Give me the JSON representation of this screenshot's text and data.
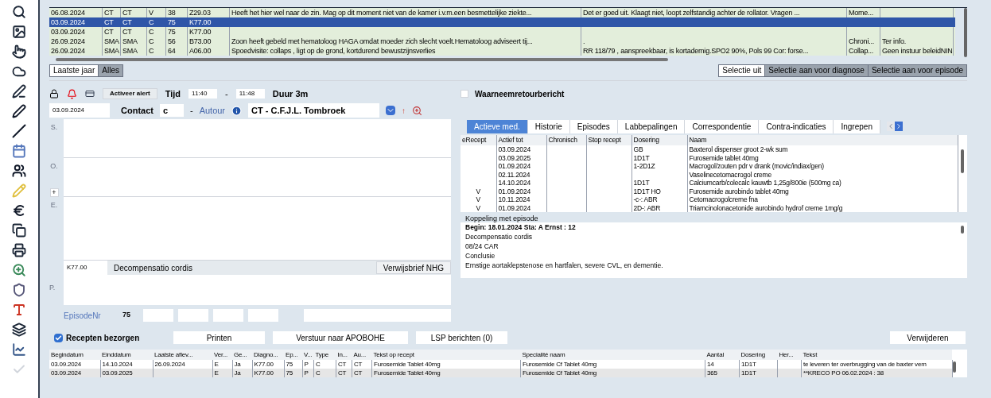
{
  "journal_table": {
    "rows": [
      {
        "selected": false,
        "cells": [
          "06.08.2024",
          "CT",
          "CT",
          "V",
          "38",
          "Z29.03",
          "Heeft het hier wel naar de zin. Mag op dit moment niet van de kamer i.v.m.een besmettelijke ziekte...",
          "Det er goed uit. Klaagt niet, loopt zelfstandig achter de rollator. Vragen ...",
          "Mome...",
          ""
        ]
      },
      {
        "selected": true,
        "cells": [
          "03.09.2024",
          "CT",
          "CT",
          "C",
          "75",
          "K77.00",
          "",
          "",
          "",
          ""
        ]
      },
      {
        "selected": false,
        "cells": [
          "03.09.2024",
          "CT",
          "CT",
          "C",
          "75",
          "K77.00",
          "",
          "",
          "",
          ""
        ]
      },
      {
        "selected": false,
        "cells": [
          "26.09.2024",
          "SMA",
          "SMA",
          "C",
          "56",
          "B73.00",
          "Zoon heeft gebeld met hematoloog HAGA omdat moeder zich slecht voelt.Hematoloog adviseert tij...",
          ".",
          "Chroni...",
          "Ter info."
        ]
      },
      {
        "selected": false,
        "cells": [
          "26.09.2024",
          "SMA",
          "SMA",
          "C",
          "64",
          "A06.00",
          "Spoedvisite: collaps , ligt op de grond, kortdurend bewustzijnsverlies",
          "RR 118/79 , aanspreekbaar, is kortademig.SPO2 90%, Pols 99 Cor: forse...",
          "Collap...",
          "Geen instuur beleidNIN"
        ]
      }
    ]
  },
  "period_filter": [
    {
      "label": "Laatste jaar",
      "selected": true
    },
    {
      "label": "Alles",
      "selected": false
    }
  ],
  "selection_filter": [
    {
      "label": "Selectie uit",
      "selected": true
    },
    {
      "label": "Selectie aan voor diagnose",
      "selected": false
    },
    {
      "label": "Selectie aan voor episode",
      "selected": false
    }
  ],
  "consult": {
    "alert_button": "Activeer alert",
    "time_label": "Tijd",
    "time_from": "11:40",
    "time_sep": "-",
    "time_to": "11:48",
    "duration": "Duur 3m",
    "date": "03.09.2024",
    "contact_label": "Contact",
    "contact_value": "c",
    "contact_sep": "-",
    "author_link": "Autour",
    "author": "CT - C.F.J.L. Tombroek",
    "author_mark": "↑",
    "soep": [
      {
        "label": "S."
      },
      {
        "label": "O."
      },
      {
        "label": "E."
      }
    ],
    "o_add": "+",
    "diagnosis_code": "K77.00",
    "diagnosis_text": "Decompensatio cordis",
    "referral_button": "Verwijsbrief NHG",
    "p_label": "P.",
    "episode_label": "EpisodeNr",
    "episode_value": "75"
  },
  "observer_report": {
    "label": "Waarneemretourbericht",
    "checked": false
  },
  "tabs": [
    {
      "label": "Actieve med.",
      "selected": true
    },
    {
      "label": "Historie",
      "selected": false
    },
    {
      "label": "Episodes",
      "selected": false
    },
    {
      "label": "Labbepalingen",
      "selected": false
    },
    {
      "label": "Correspondentie",
      "selected": false
    },
    {
      "label": "Contra-indicaties",
      "selected": false
    },
    {
      "label": "Ingrepen",
      "selected": false
    }
  ],
  "medication_table": {
    "columns": [
      "eRecept",
      "Actief tot",
      "Chronisch",
      "Stop recept",
      "Dosering",
      "Naam"
    ],
    "rows": [
      [
        "",
        "03.09.2024",
        "",
        "",
        "GB",
        "Baxterol dispenser groot 2-wk sum"
      ],
      [
        "",
        "03.09.2025",
        "",
        "",
        "1D1T",
        "Furosemide tablet 40mg"
      ],
      [
        "",
        "01.09.2024",
        "",
        "",
        "1-2D1Z",
        "Macrogol/zouten pdr v drank (movic/indiax/gen)"
      ],
      [
        "",
        "02.11.2024",
        "",
        "",
        "",
        "Vaselinecetomacrogol creme"
      ],
      [
        "",
        "14.10.2024",
        "",
        "",
        "1D1T",
        "Calciumcarb/colecalc kauwtb 1,25g/800ie (500mg ca)"
      ],
      [
        "V",
        "01.09.2024",
        "",
        "",
        "1D1T HO",
        "Furosemide aurobindo tablet 40mg"
      ],
      [
        "V",
        "10.11.2024",
        "",
        "",
        "-c-: ABR",
        "Cetomacrogolcreme fna"
      ],
      [
        "V",
        "01.09.2024",
        "",
        "",
        "2D-: ABR",
        "Triamcinolonacetonide aurobindo hydrof creme 1mg/g"
      ]
    ]
  },
  "episode_link": {
    "title": "Koppeling met episode",
    "lines": [
      "Begin: 18.01.2024  Sta: A  Ernst : 12",
      "Decompensatio cordis",
      "08/24 CAR",
      "Conclusie",
      "Ernstige aortaklepstenose en hartfalen, severe CVL, en dementie."
    ]
  },
  "prescriptions": {
    "delivered": {
      "label": "Recepten bezorgen",
      "checked": true
    },
    "buttons": [
      "Printen",
      "Verstuur naar APOBOHE",
      "LSP berichten (0)"
    ],
    "delete_button": "Verwijderen",
    "columns": [
      "Begindatum",
      "Einddatum",
      "Laatste aflev...",
      "Ver...",
      "Ge...",
      "Diagno...",
      "Ep...",
      "V...",
      "Type",
      "In...",
      "Au...",
      "Tekst op recept",
      "Specialité naam",
      "Aantal",
      "Dosering",
      "Her...",
      "Tekst"
    ],
    "rows": [
      [
        "03.09.2024",
        "14.10.2024",
        "26.09.2024",
        "E",
        "Ja",
        "K77.00",
        "75",
        "P",
        "C",
        "CT",
        "CT",
        "Furosemide Tablet 40mg",
        "Furosemide Cf Tablet 40mg",
        "14",
        "1D1T",
        "",
        "te leveren ter overbrugging van de baxter vem"
      ],
      [
        "03.09.2024",
        "03.09.2025",
        "",
        "E",
        "Ja",
        "K77.00",
        "75",
        "P",
        "C",
        "CT",
        "CT",
        "Furosemide Tablet 40mg",
        "Furosemide Cf Tablet 40mg",
        "365",
        "1D1T",
        "",
        "**KRECO PO 06.02.2024 : 38"
      ]
    ]
  }
}
